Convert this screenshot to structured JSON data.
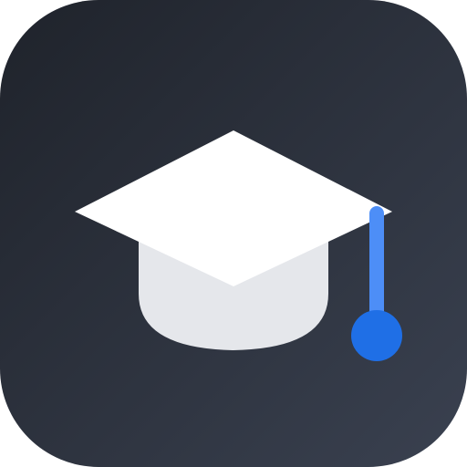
{
  "icon": {
    "name": "graduation-cap-icon",
    "colors": {
      "background_start": "#1f232b",
      "background_end": "#3a4150",
      "board_top": "#ffffff",
      "cap_base": "#e5e7eb",
      "tassel_cord": "#4d8ef7",
      "tassel_knot": "#1f6fe6"
    }
  }
}
